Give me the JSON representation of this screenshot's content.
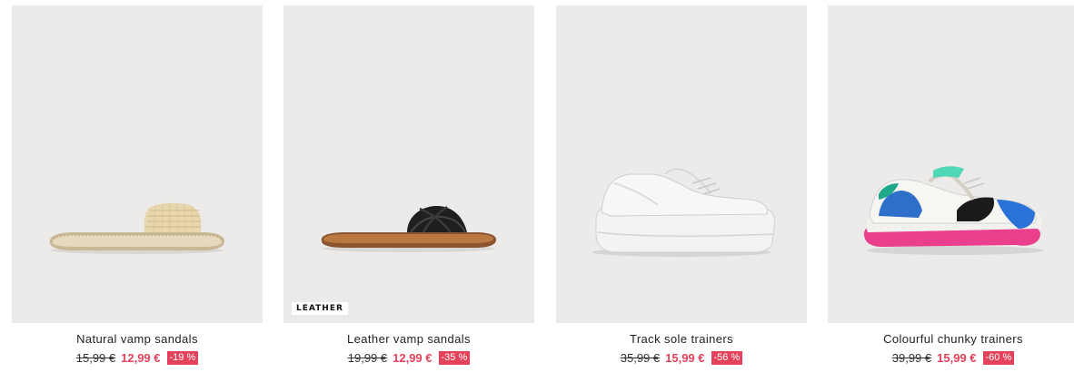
{
  "products": [
    {
      "name": "Natural vamp sandals",
      "old_price": "15,99 €",
      "price": "12,99 €",
      "discount": "-19 %",
      "image": "natural-vamp-sandal-image"
    },
    {
      "name": "Leather vamp sandals",
      "old_price": "19,99 €",
      "price": "12,99 €",
      "discount": "-35 %",
      "badge": "LEATHER",
      "image": "leather-vamp-sandal-image"
    },
    {
      "name": "Track sole trainers",
      "old_price": "35,99 €",
      "price": "15,99 €",
      "discount": "-56 %",
      "image": "white-trainer-image"
    },
    {
      "name": "Colourful chunky trainers",
      "old_price": "39,99 €",
      "price": "15,99 €",
      "discount": "-60 %",
      "image": "colourful-trainer-image"
    }
  ],
  "colors": {
    "sale": "#e3425a",
    "image_bg": "#ecebea",
    "text": "#222222"
  }
}
